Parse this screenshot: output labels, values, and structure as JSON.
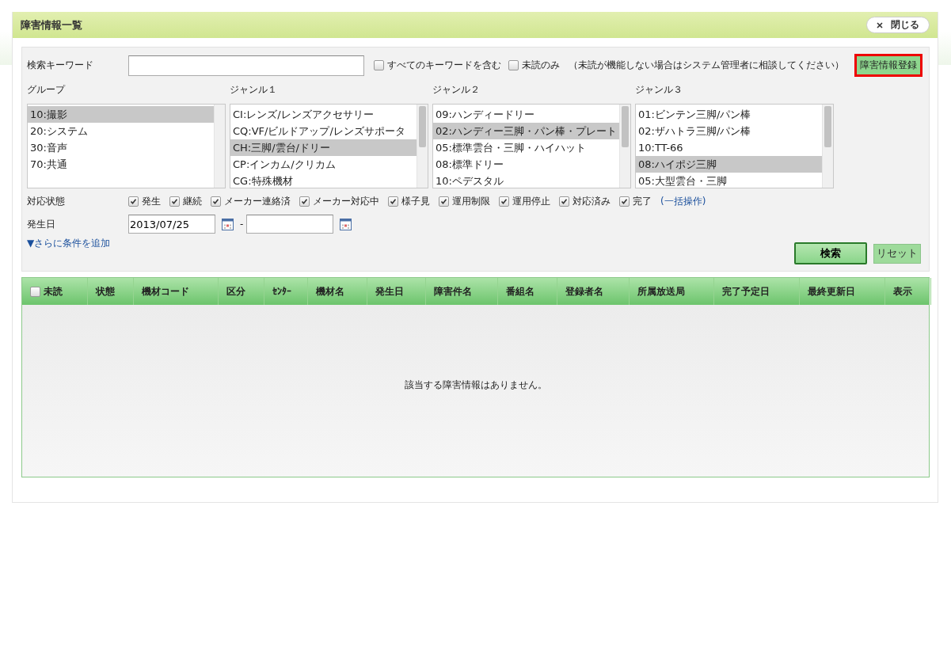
{
  "window": {
    "title": "障害情報一覧",
    "close_button": "閉じる"
  },
  "keyword": {
    "label": "検索キーワード",
    "options": [
      {
        "label": "すべてのキーワードを含む",
        "checked": false
      },
      {
        "label": "未読のみ",
        "checked": false
      }
    ],
    "note": "（未読が機能しない場合はシステム管理者に相談してください）",
    "register_button": "障害情報登録"
  },
  "lists": [
    {
      "label": "グループ",
      "items": [
        {
          "text": "10:撮影",
          "selected": true
        },
        {
          "text": "20:システム",
          "selected": false
        },
        {
          "text": "30:音声",
          "selected": false
        },
        {
          "text": "70:共通",
          "selected": false
        }
      ]
    },
    {
      "label": "ジャンル１",
      "items": [
        {
          "text": "CI:レンズ/レンズアクセサリー",
          "selected": false
        },
        {
          "text": "CQ:VF/ビルドアップ/レンズサポータ",
          "selected": false
        },
        {
          "text": "CH:三脚/雲台/ドリー",
          "selected": true
        },
        {
          "text": "CP:インカム/クリカム",
          "selected": false
        },
        {
          "text": "CG:特殊機材",
          "selected": false
        }
      ]
    },
    {
      "label": "ジャンル２",
      "items": [
        {
          "text": "09:ハンディードリー",
          "selected": false
        },
        {
          "text": "02:ハンディー三脚・パン棒・プレート",
          "selected": true
        },
        {
          "text": "05:標準雲台・三脚・ハイハット",
          "selected": false
        },
        {
          "text": "08:標準ドリー",
          "selected": false
        },
        {
          "text": "10:ペデスタル",
          "selected": false
        }
      ]
    },
    {
      "label": "ジャンル３",
      "items": [
        {
          "text": "01:ビンテン三脚/パン棒",
          "selected": false
        },
        {
          "text": "02:ザハトラ三脚/パン棒",
          "selected": false
        },
        {
          "text": "10:TT-66",
          "selected": false
        },
        {
          "text": "08:ハイポジ三脚",
          "selected": true
        },
        {
          "text": "05:大型雲台・三脚",
          "selected": false
        }
      ]
    }
  ],
  "status": {
    "label": "対応状態",
    "options": [
      {
        "label": "発生",
        "checked": true
      },
      {
        "label": "継続",
        "checked": true
      },
      {
        "label": "メーカー連絡済",
        "checked": true
      },
      {
        "label": "メーカー対応中",
        "checked": true
      },
      {
        "label": "様子見",
        "checked": true
      },
      {
        "label": "運用制限",
        "checked": true
      },
      {
        "label": "運用停止",
        "checked": true
      },
      {
        "label": "対応済み",
        "checked": true
      },
      {
        "label": "完了",
        "checked": true
      }
    ],
    "bulk_link": "(一括操作)"
  },
  "date": {
    "label": "発生日",
    "from": "2013/07/25",
    "separator": "-"
  },
  "more_conditions": "▼さらに条件を追加",
  "search_button": "検索",
  "reset_button": "リセット",
  "table": {
    "unread_checked": false,
    "columns": [
      "未読",
      "状態",
      "機材コード",
      "区分",
      "ｾﾝﾀｰ",
      "機材名",
      "発生日",
      "障害件名",
      "番組名",
      "登録者名",
      "所属放送局",
      "完了予定日",
      "最終更新日",
      "表示"
    ],
    "empty_message": "該当する障害情報はありません。"
  }
}
